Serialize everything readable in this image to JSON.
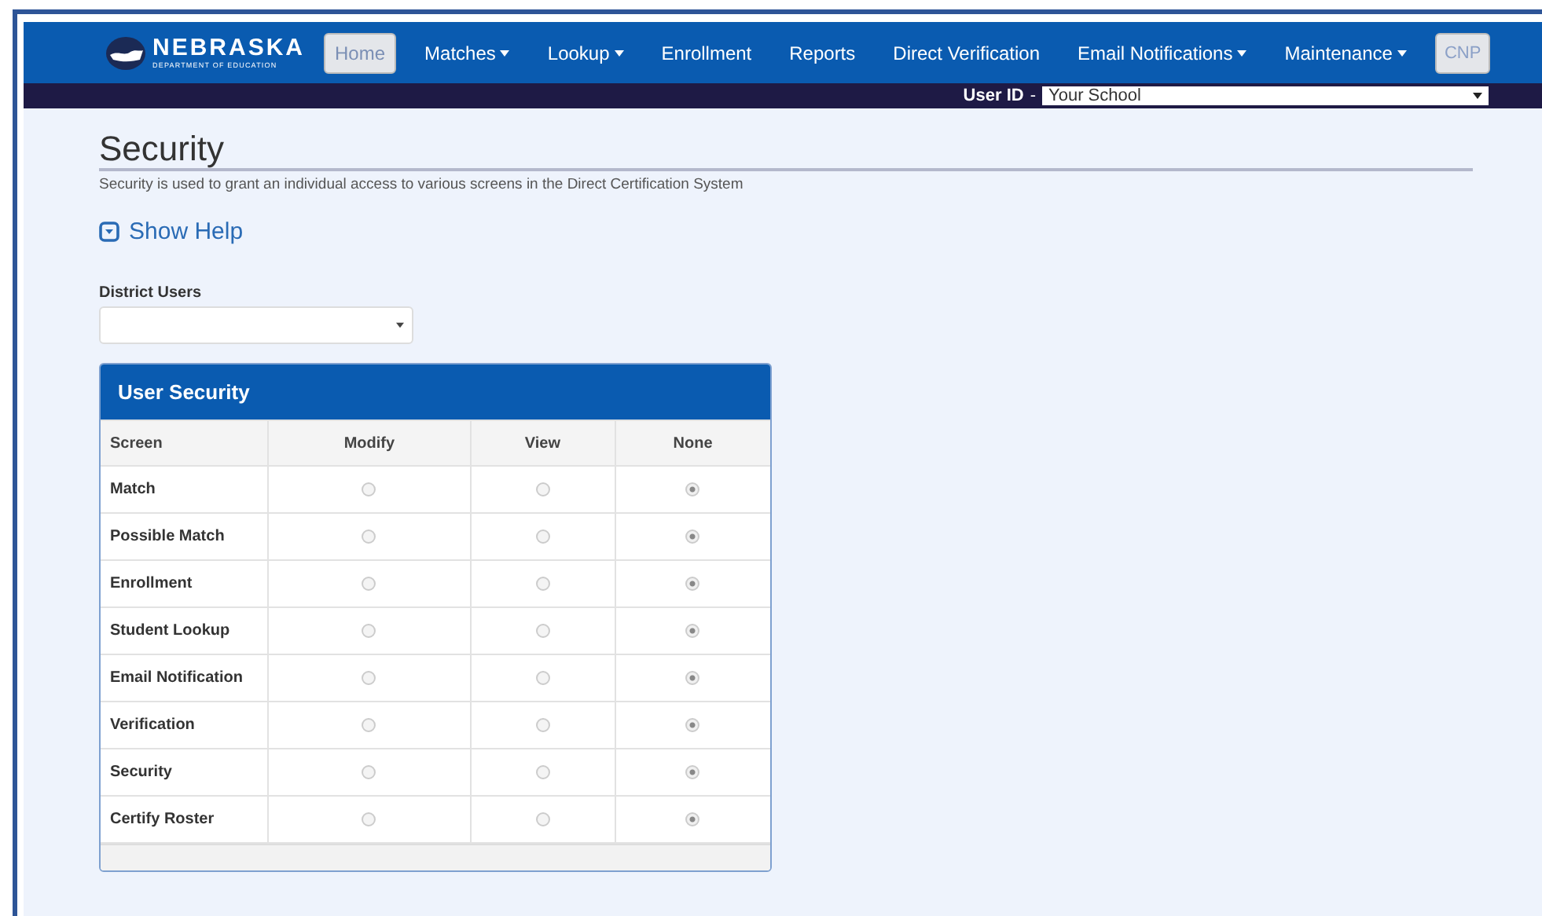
{
  "logo": {
    "name": "NEBRASKA",
    "subtitle": "DEPARTMENT OF EDUCATION"
  },
  "nav": [
    {
      "label": "Home",
      "dropdown": false,
      "selected": true
    },
    {
      "label": "Matches",
      "dropdown": true,
      "selected": false
    },
    {
      "label": "Lookup",
      "dropdown": true,
      "selected": false
    },
    {
      "label": "Enrollment",
      "dropdown": false,
      "selected": false
    },
    {
      "label": "Reports",
      "dropdown": false,
      "selected": false
    },
    {
      "label": "Direct Verification",
      "dropdown": false,
      "selected": false
    },
    {
      "label": "Email Notifications",
      "dropdown": true,
      "selected": false
    },
    {
      "label": "Maintenance",
      "dropdown": true,
      "selected": false
    }
  ],
  "nav_button": "CNP",
  "user_bar": {
    "label": "User ID",
    "separator": "-",
    "value": "Your School"
  },
  "page": {
    "title": "Security",
    "description": "Security is used to grant an individual access to various screens in the Direct Certification System",
    "help_link": "Show Help"
  },
  "district_users": {
    "label": "District Users"
  },
  "panel": {
    "title": "User Security",
    "columns": [
      "Screen",
      "Modify",
      "View",
      "None"
    ],
    "rows": [
      {
        "screen": "Match",
        "options": [
          {
            "selected": false
          },
          {
            "selected": false
          },
          {
            "selected": true
          }
        ]
      },
      {
        "screen": "Possible Match",
        "options": [
          {
            "selected": false
          },
          {
            "selected": false
          },
          {
            "selected": true
          }
        ]
      },
      {
        "screen": "Enrollment",
        "options": [
          {
            "selected": false
          },
          {
            "selected": false
          },
          {
            "selected": true
          }
        ]
      },
      {
        "screen": "Student Lookup",
        "options": [
          {
            "selected": false
          },
          {
            "selected": false
          },
          {
            "selected": true
          }
        ]
      },
      {
        "screen": "Email Notification",
        "options": [
          {
            "selected": false
          },
          {
            "selected": false
          },
          {
            "selected": true
          }
        ]
      },
      {
        "screen": "Verification",
        "options": [
          {
            "selected": false
          },
          {
            "selected": false
          },
          {
            "selected": true
          }
        ]
      },
      {
        "screen": "Security",
        "options": [
          {
            "selected": false
          },
          {
            "selected": false
          },
          {
            "selected": true
          }
        ]
      },
      {
        "screen": "Certify Roster",
        "options": [
          {
            "selected": false
          },
          {
            "selected": false
          },
          {
            "selected": true
          }
        ]
      }
    ]
  }
}
